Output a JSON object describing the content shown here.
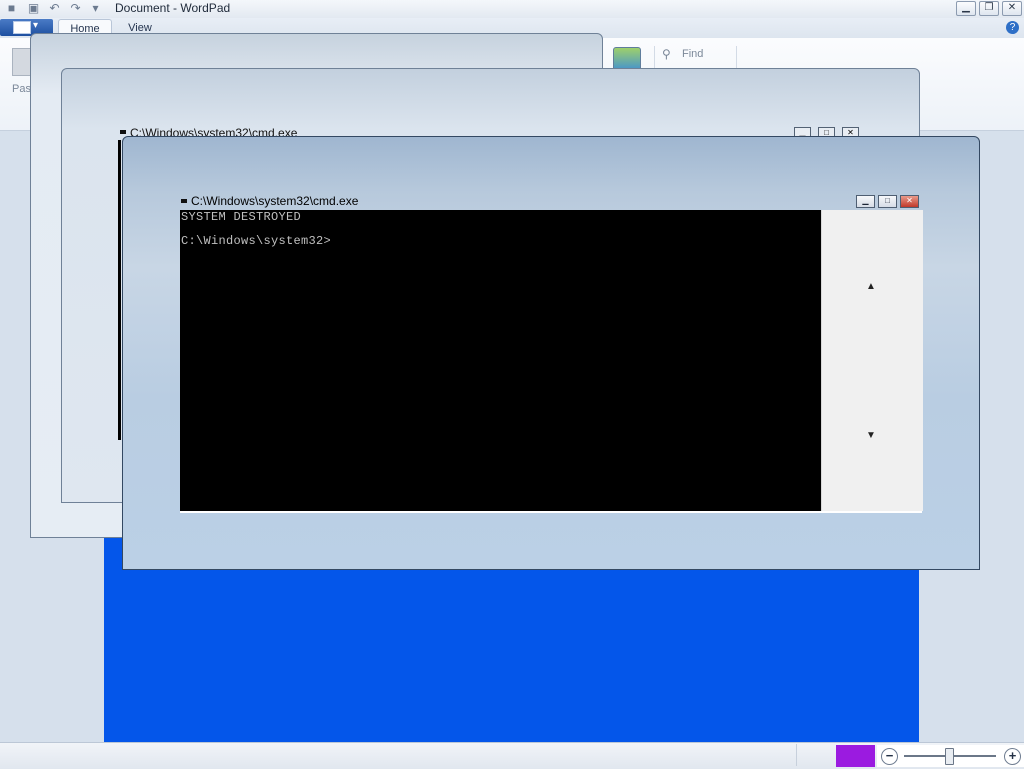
{
  "wordpad": {
    "title": "Document - WordPad",
    "tabs": [
      {
        "label": "Home"
      },
      {
        "label": "View"
      }
    ],
    "ribbon": {
      "paste_label": "Pas",
      "find_label": "Find"
    },
    "window_buttons": {
      "minimize": "▁",
      "maximize": "❐",
      "close": "✕"
    },
    "help_glyph": "?",
    "document_color": "#0456ea",
    "zoom": {
      "out_glyph": "−",
      "in_glyph": "+"
    }
  },
  "ghost_window": {
    "title": "C:\\Windows\\system32\\cmd.exe"
  },
  "cmd": {
    "title": "C:\\Windows\\system32\\cmd.exe",
    "lines": [
      "SYSTEM DESTROYED",
      "C:\\Windows\\system32>"
    ],
    "buttons": {
      "minimize": "▁",
      "maximize": "□",
      "close": "✕"
    },
    "scroll": {
      "up_glyph": "▲",
      "down_glyph": "▼"
    }
  },
  "colors": {
    "zoom_highlight": "#9b1be0",
    "console_bg": "#000000",
    "console_fg": "#c0c0c0"
  }
}
